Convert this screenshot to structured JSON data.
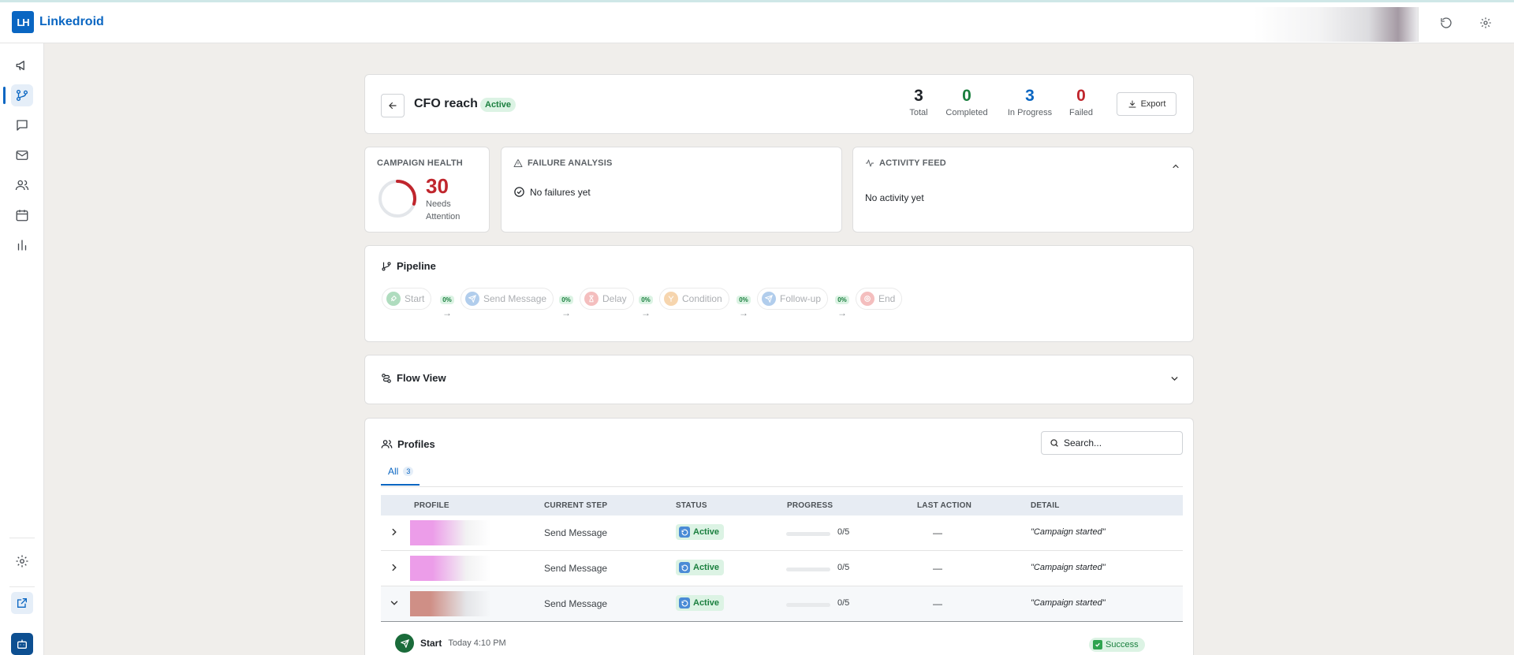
{
  "app": {
    "name": "Linkedroid",
    "logo_text": "LH"
  },
  "header": {
    "refresh_icon": "refresh-icon",
    "settings_icon": "gear-icon"
  },
  "sidebar": {
    "items": [
      {
        "id": "campaigns",
        "icon": "megaphone-icon",
        "active": false
      },
      {
        "id": "workflows",
        "icon": "branch-icon",
        "active": true
      },
      {
        "id": "messages",
        "icon": "chat-icon",
        "active": false
      },
      {
        "id": "inbox",
        "icon": "mail-icon",
        "active": false
      },
      {
        "id": "contacts",
        "icon": "users-icon",
        "active": false
      },
      {
        "id": "calendar",
        "icon": "calendar-icon",
        "active": false
      },
      {
        "id": "analytics",
        "icon": "bar-chart-icon",
        "active": false
      }
    ],
    "bottom": [
      "gear-icon",
      "external-link-icon",
      "bot-icon"
    ]
  },
  "campaign": {
    "title": "CFO reach",
    "status": "Active",
    "stats": [
      {
        "value": "3",
        "label": "Total",
        "color": "#1f2328"
      },
      {
        "value": "0",
        "label": "Completed",
        "color": "#1a7f3e"
      },
      {
        "value": "3",
        "label": "In Progress",
        "color": "#0a66c2"
      },
      {
        "value": "0",
        "label": "Failed",
        "color": "#c0262d"
      }
    ],
    "export_label": "Export"
  },
  "health": {
    "title": "CAMPAIGN HEALTH",
    "score": "30",
    "score_fraction": 0.3,
    "label": "Needs Attention",
    "color": "#c0262d"
  },
  "failure": {
    "title": "FAILURE ANALYSIS",
    "message": "No failures yet"
  },
  "activity": {
    "title": "ACTIVITY FEED",
    "message": "No activity yet"
  },
  "pipeline": {
    "title": "Pipeline",
    "steps": [
      {
        "label": "Start",
        "color": "#1a7f3e"
      },
      {
        "label": "Send Message",
        "color": "#0a66c2"
      },
      {
        "label": "Delay",
        "color": "#e25c5c"
      },
      {
        "label": "Condition",
        "color": "#f0962c"
      },
      {
        "label": "Follow-up",
        "color": "#0a66c2"
      },
      {
        "label": "End",
        "color": "#e25c5c"
      }
    ],
    "connectors": [
      "0%",
      "0%",
      "0%",
      "0%",
      "0%"
    ]
  },
  "flow_view": {
    "title": "Flow View"
  },
  "profiles": {
    "title": "Profiles",
    "search_placeholder": "Search...",
    "tabs": [
      {
        "label": "All",
        "count": "3"
      }
    ],
    "columns": [
      "PROFILE",
      "CURRENT STEP",
      "STATUS",
      "PROGRESS",
      "LAST ACTION",
      "DETAIL"
    ],
    "rows": [
      {
        "step": "Send Message",
        "status": "Active",
        "progress": "0/5",
        "progress_fraction": 0,
        "last_action": "—",
        "detail": "\"Campaign started\"",
        "expanded": false,
        "accent": "#ec9de9"
      },
      {
        "step": "Send Message",
        "status": "Active",
        "progress": "0/5",
        "progress_fraction": 0,
        "last_action": "—",
        "detail": "\"Campaign started\"",
        "expanded": false,
        "accent": "#ec9de9"
      },
      {
        "step": "Send Message",
        "status": "Active",
        "progress": "0/5",
        "progress_fraction": 0,
        "last_action": "—",
        "detail": "\"Campaign started\"",
        "expanded": true,
        "accent": "#cf8f86"
      }
    ],
    "expanded_detail": {
      "step": "Start",
      "time": "Today 4:10 PM",
      "result": "Success"
    }
  }
}
